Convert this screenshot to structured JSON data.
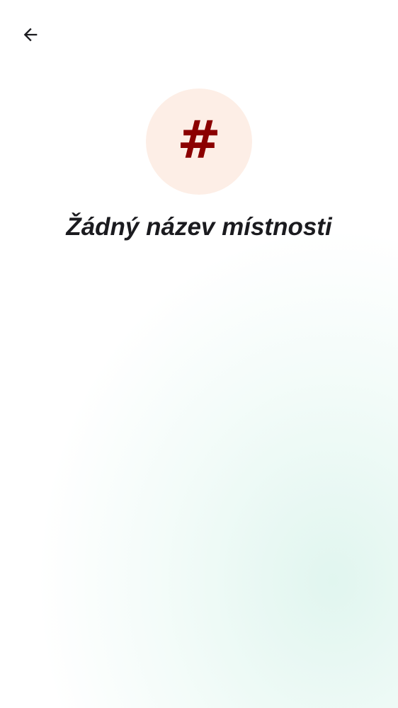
{
  "colors": {
    "text_primary": "#1b1b1f",
    "avatar_bg": "#fdeee6",
    "avatar_glyph": "#8b0000",
    "background_tint": "#e3f6ef"
  },
  "header": {
    "back_icon": "arrow-left-icon"
  },
  "room": {
    "avatar_glyph": "#",
    "title": "Žádný název místnosti"
  }
}
